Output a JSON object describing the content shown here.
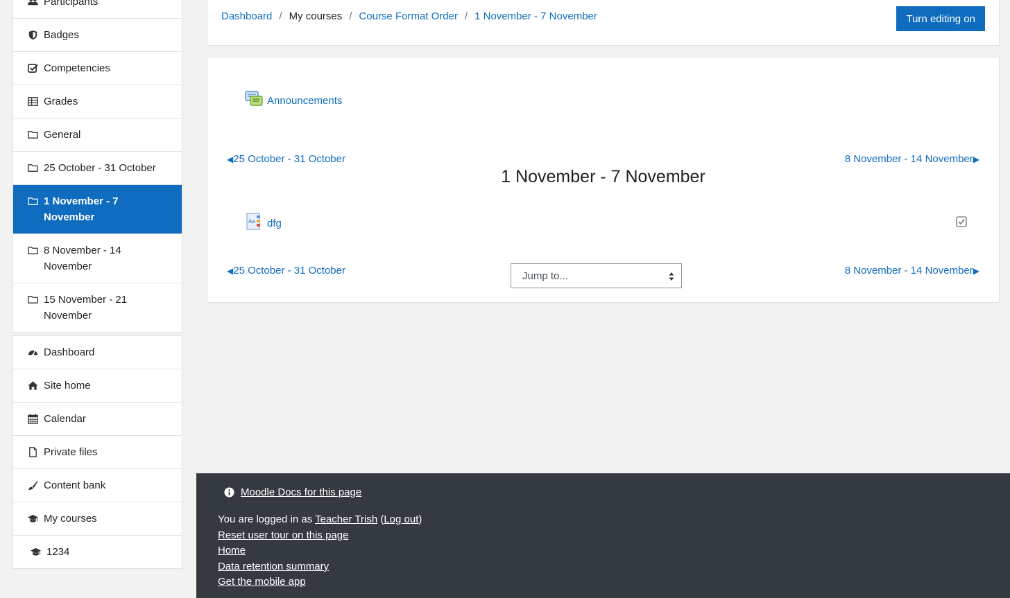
{
  "sidebar": {
    "course_nav": [
      {
        "label": "Participants",
        "icon": "users-icon"
      },
      {
        "label": "Badges",
        "icon": "shield-icon"
      },
      {
        "label": "Competencies",
        "icon": "check-square-icon"
      },
      {
        "label": "Grades",
        "icon": "table-icon"
      },
      {
        "label": "General",
        "icon": "folder-icon"
      },
      {
        "label": "25 October - 31 October",
        "icon": "folder-icon"
      },
      {
        "label": "1 November - 7 November",
        "icon": "folder-icon",
        "active": true
      },
      {
        "label": "8 November - 14 November",
        "icon": "folder-icon"
      },
      {
        "label": "15 November - 21 November",
        "icon": "folder-icon"
      }
    ],
    "site_nav": [
      {
        "label": "Dashboard",
        "icon": "tachometer-icon"
      },
      {
        "label": "Site home",
        "icon": "home-icon"
      },
      {
        "label": "Calendar",
        "icon": "calendar-icon"
      },
      {
        "label": "Private files",
        "icon": "file-icon"
      },
      {
        "label": "Content bank",
        "icon": "paint-brush-icon"
      },
      {
        "label": "My courses",
        "icon": "graduation-cap-icon"
      },
      {
        "label": "1234",
        "icon": "graduation-cap-icon"
      }
    ]
  },
  "header": {
    "breadcrumb": {
      "dashboard": "Dashboard",
      "sep": "/",
      "my_courses": "My courses",
      "course": "Course Format Order",
      "section": "1 November - 7 November"
    },
    "editing_button": "Turn editing on"
  },
  "main": {
    "announcements": "Announcements",
    "prev_section": "25 October - 31 October",
    "next_section": "8 November - 14 November",
    "arrow_left": "◀",
    "arrow_right": "▶",
    "section_title": "1 November - 7 November",
    "activity_name": "dfg",
    "jump_placeholder": "Jump to..."
  },
  "footer": {
    "docs_link": "Moodle Docs for this page",
    "logged_in_prefix": "You are logged in as ",
    "user_name": "Teacher Trish",
    "open_paren": " (",
    "logout": "Log out",
    "close_paren": ")",
    "reset_tour": "Reset user tour on this page",
    "home": "Home",
    "data_retention": "Data retention summary",
    "mobile_app": "Get the mobile app"
  },
  "colors": {
    "primary": "#0f6cbf",
    "footer_bg": "#343a40",
    "page_bg": "#f2f2f2"
  }
}
